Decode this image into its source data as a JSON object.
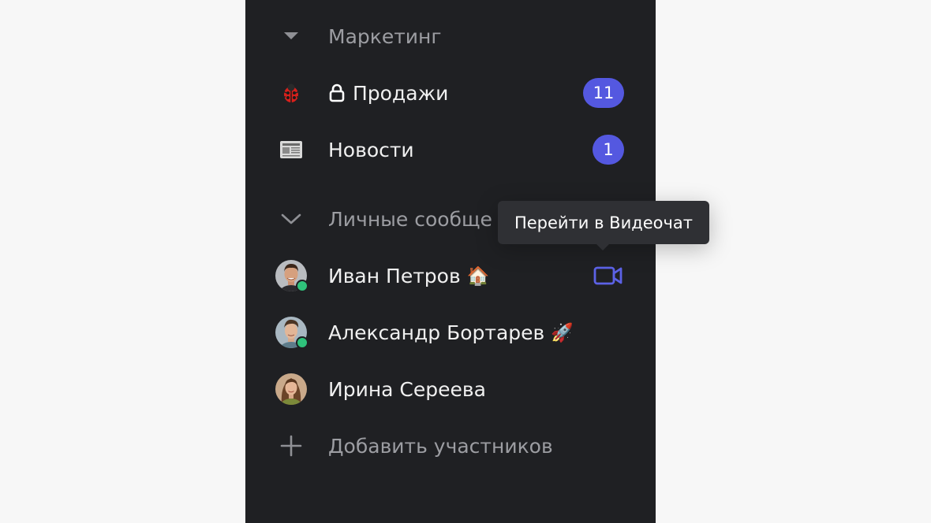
{
  "sections": {
    "marketing": {
      "label": "Маркетинг",
      "icon": "caret-down-icon"
    },
    "channels": [
      {
        "icon": "ladybug-icon",
        "lock_icon": "lock-icon",
        "label": "Продажи",
        "badge": "11"
      },
      {
        "icon": "newspaper-icon",
        "label": "Новости",
        "badge": "1"
      }
    ],
    "direct_messages": {
      "label": "Личные сообще",
      "icon": "chevron-down-icon"
    },
    "people": [
      {
        "name": "Иван Петров",
        "status_emoji": "🏠",
        "online": true
      },
      {
        "name": "Александр Бортарев",
        "status_emoji": "🚀",
        "online": true
      },
      {
        "name": "Ирина Сереева",
        "status_emoji": "",
        "online": false
      }
    ],
    "add_members": {
      "label": "Добавить участников",
      "icon": "plus-icon"
    }
  },
  "tooltip": {
    "text": "Перейти в Видеочат"
  },
  "colors": {
    "sidebar_bg": "#1f2023",
    "badge": "#5458e0",
    "presence": "#2fc27b",
    "video_icon": "#5c62e6"
  }
}
